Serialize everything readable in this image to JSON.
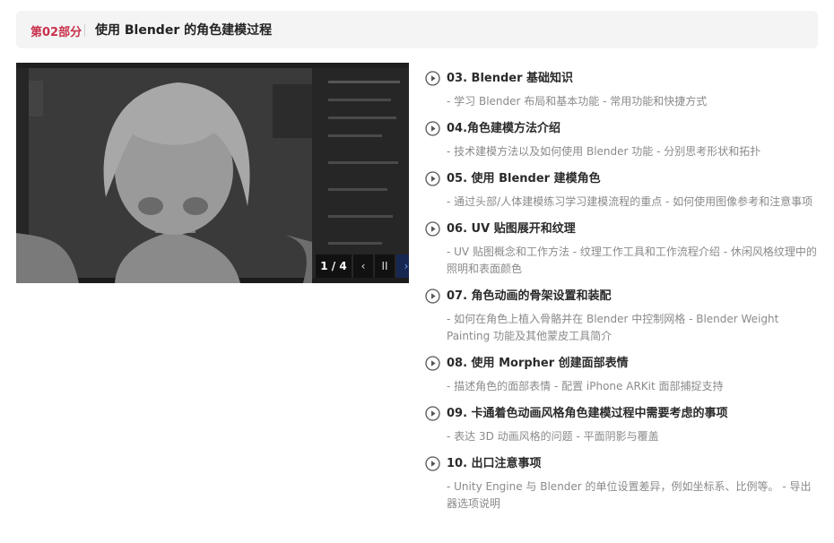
{
  "header": {
    "part_label": "第02部分",
    "title": "使用 Blender 的角色建模过程"
  },
  "viewer": {
    "counter": "1 / 4",
    "prev_label": "‹",
    "pause_label": "II",
    "next_label": "›"
  },
  "lessons": [
    {
      "title": "03. Blender 基础知识",
      "desc": "- 学习 Blender 布局和基本功能 - 常用功能和快捷方式"
    },
    {
      "title": "04.角色建模方法介绍",
      "desc": "- 技术建模方法以及如何使用 Blender 功能 - 分别思考形状和拓扑"
    },
    {
      "title": "05. 使用 Blender 建模角色",
      "desc": "- 通过头部/人体建模练习学习建模流程的重点 - 如何使用图像参考和注意事项"
    },
    {
      "title": "06. UV 贴图展开和纹理",
      "desc": "- UV 贴图概念和工作方法 - 纹理工作工具和工作流程介绍 - 休闲风格纹理中的照明和表面颜色"
    },
    {
      "title": "07. 角色动画的骨架设置和装配",
      "desc": "- 如何在角色上植入骨骼并在 Blender 中控制网格 - Blender Weight Painting 功能及其他蒙皮工具简介"
    },
    {
      "title": "08. 使用 Morpher 创建面部表情",
      "desc": "- 描述角色的面部表情 - 配置 iPhone ARKit 面部捕捉支持"
    },
    {
      "title": "09. 卡通着色动画风格角色建模过程中需要考虑的事项",
      "desc": "- 表达 3D 动画风格的问题 - 平面阴影与覆盖"
    },
    {
      "title": "10. 出口注意事项",
      "desc": "- Unity Engine 与 Blender 的单位设置差异，例如坐标系、比例等。 - 导出器选项说明"
    }
  ],
  "colors": {
    "accent": "#c8304a",
    "header_bg": "#f4f4f5",
    "desc_text": "#8a8a8a"
  },
  "icons": [
    "play-circle-icon"
  ]
}
